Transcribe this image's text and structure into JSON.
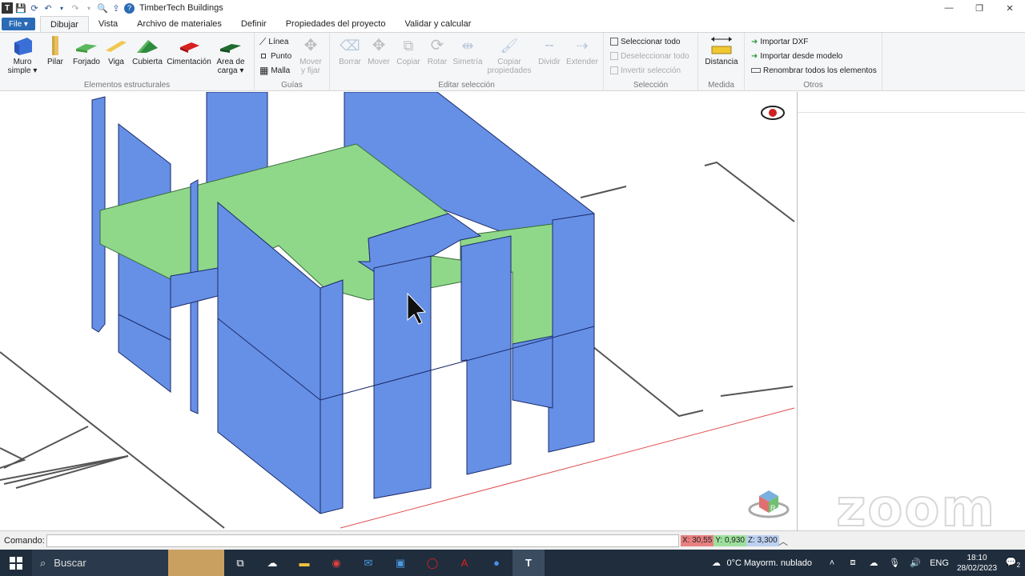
{
  "app": {
    "title": "TimberTech Buildings"
  },
  "tabs": {
    "file": "File ▾",
    "items": [
      "Dibujar",
      "Vista",
      "Archivo de materiales",
      "Definir",
      "Propiedades del proyecto",
      "Validar y calcular"
    ]
  },
  "ribbon": {
    "structural": {
      "label": "Elementos estructurales",
      "muro_a": "Muro",
      "muro_b": "simple ▾",
      "pilar": "Pilar",
      "forjado": "Forjado",
      "viga": "Viga",
      "cubierta": "Cubierta",
      "cimentacion": "Cimentación",
      "area_a": "Area de",
      "area_b": "carga ▾"
    },
    "guias": {
      "label": "Guías",
      "linea": "Línea",
      "punto": "Punto",
      "malla": "Malla",
      "mover_a": "Mover",
      "mover_b": "y fijar"
    },
    "editar": {
      "label": "Editar selección",
      "borrar": "Borrar",
      "mover": "Mover",
      "copiar": "Copiar",
      "rotar": "Rotar",
      "simetria": "Simetría",
      "copiar_prop_a": "Copiar",
      "copiar_prop_b": "propiedades",
      "dividir": "Dividir",
      "extender": "Extender"
    },
    "seleccion": {
      "label": "Selección",
      "todo": "Seleccionar todo",
      "deseleccionar": "Deseleccionar todo",
      "invertir": "Invertir selección"
    },
    "medida": {
      "label": "Medida",
      "distancia": "Distancia"
    },
    "otros": {
      "label": "Otros",
      "dxf": "Importar DXF",
      "modelo": "Importar desde modelo",
      "renombrar": "Renombrar todos los elementos"
    }
  },
  "viewport": {
    "orbit_label": "R",
    "watermark": "zoom"
  },
  "command": {
    "label": "Comando:",
    "value": ""
  },
  "coords": {
    "x": "X: 30,55",
    "y": "Y: 0,930",
    "z": "Z: 3,300"
  },
  "taskbar": {
    "search": "Buscar",
    "weather": "0°C  Mayorm. nublado",
    "lang": "ENG",
    "time": "18:10",
    "date": "28/02/2023",
    "notifications": "2"
  },
  "colors": {
    "wall": "#6690e6",
    "slab": "#8fd88a",
    "accent": "#2b6bb5"
  }
}
